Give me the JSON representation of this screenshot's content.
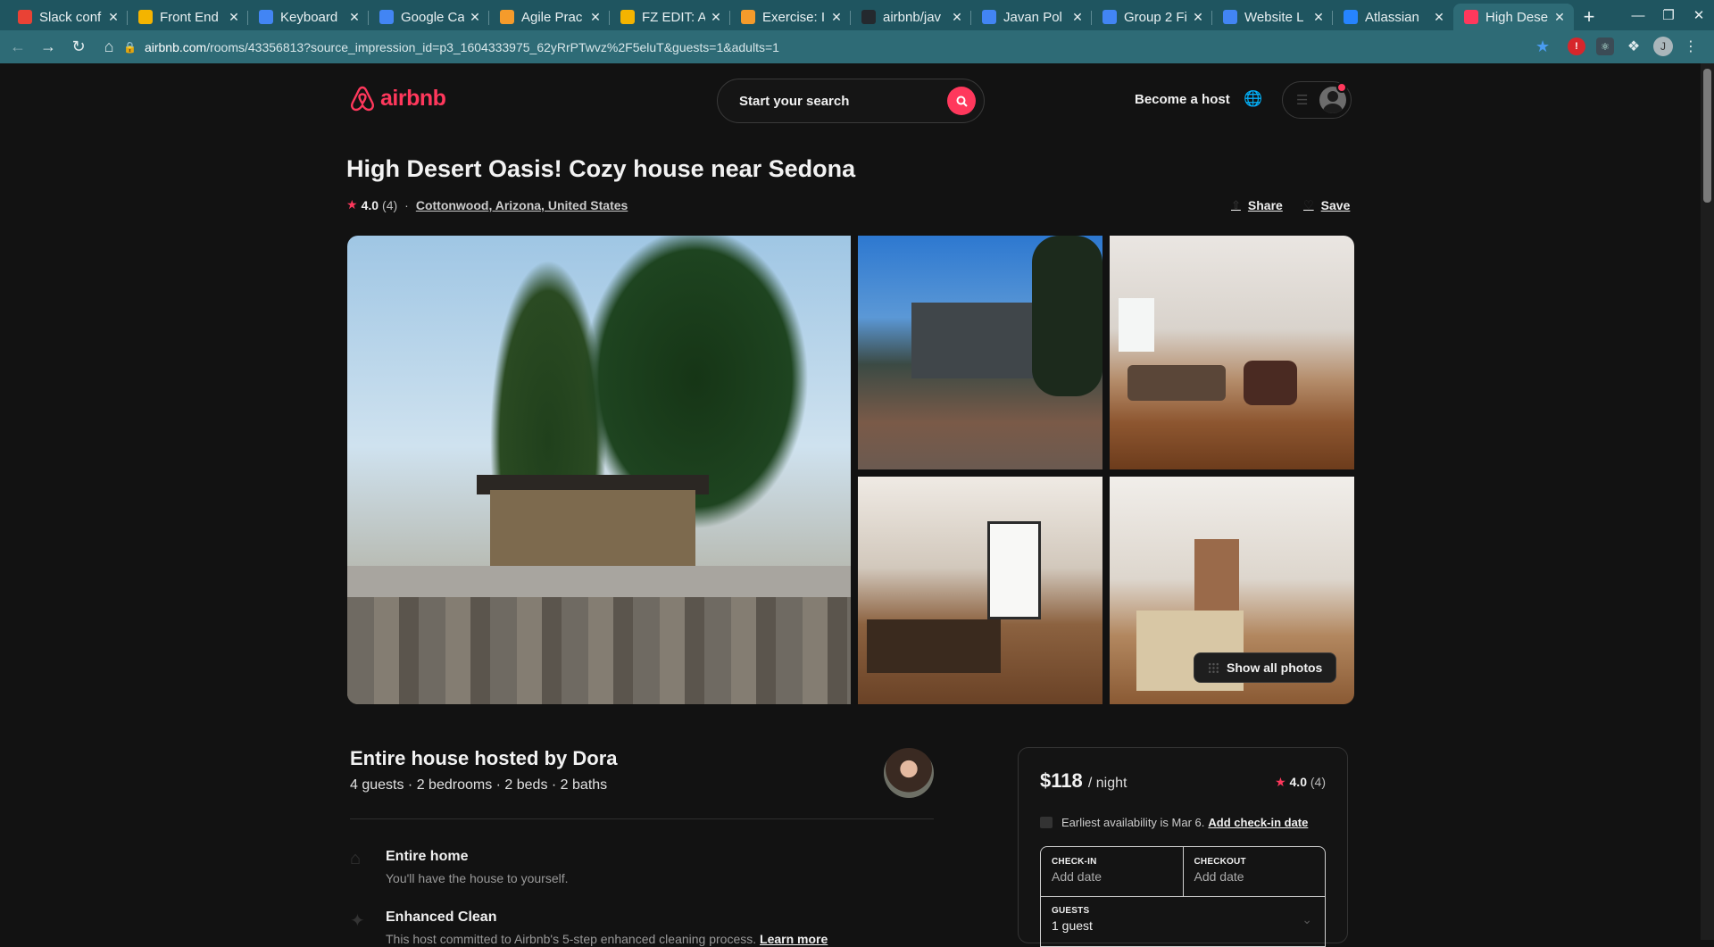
{
  "browser": {
    "tabs": [
      {
        "title": "Slack conf",
        "icon": "gmail-icon",
        "color": "#e94235"
      },
      {
        "title": "Front End",
        "icon": "drive-icon",
        "color": "#f4b400"
      },
      {
        "title": "Keyboard",
        "icon": "docs-icon",
        "color": "#4285f4"
      },
      {
        "title": "Google Ca",
        "icon": "slides-icon",
        "color": "#4285f4"
      },
      {
        "title": "Agile Prac",
        "icon": "kajabi-icon",
        "color": "#f59b2b"
      },
      {
        "title": "FZ EDIT: A",
        "icon": "slides-icon",
        "color": "#f4b400"
      },
      {
        "title": "Exercise: I",
        "icon": "kajabi-icon",
        "color": "#f59b2b"
      },
      {
        "title": "airbnb/jav",
        "icon": "github-icon",
        "color": "#24292e"
      },
      {
        "title": "Javan Pol",
        "icon": "docs-icon",
        "color": "#4285f4"
      },
      {
        "title": "Group 2 Fi",
        "icon": "docs-icon",
        "color": "#4285f4"
      },
      {
        "title": "Website L",
        "icon": "docs-icon",
        "color": "#4285f4"
      },
      {
        "title": "Atlassian",
        "icon": "atlassian-icon",
        "color": "#2684ff"
      },
      {
        "title": "High Dese",
        "icon": "airbnb-icon",
        "color": "#ff385c",
        "active": true
      }
    ],
    "url_host": "airbnb.com",
    "url_path": "/rooms/43356813?source_impression_id=p3_1604333975_62yRrPTwvz%2F5eluT&guests=1&adults=1",
    "profile_initial": "J"
  },
  "header": {
    "logo_text": "airbnb",
    "search_placeholder": "Start your search",
    "become_host": "Become a host"
  },
  "listing": {
    "title": "High Desert Oasis! Cozy house near Sedona",
    "rating": "4.0",
    "review_count": "(4)",
    "location": "Cottonwood, Arizona, United States",
    "share_label": "Share",
    "save_label": "Save",
    "show_all_photos": "Show all photos",
    "hosted_by": "Entire house hosted by Dora",
    "specs": "4 guests · 2 bedrooms · 2 beds · 2 baths",
    "features": [
      {
        "title": "Entire home",
        "desc": "You'll have the house to yourself."
      },
      {
        "title": "Enhanced Clean",
        "desc": "This host committed to Airbnb's 5-step enhanced cleaning process.",
        "link": "Learn more"
      }
    ]
  },
  "booking": {
    "price": "$118",
    "per_night": "/ night",
    "rating": "4.0",
    "review_count": "(4)",
    "availability": "Earliest availability is Mar 6.",
    "add_checkin": "Add check-in date",
    "checkin_label": "CHECK-IN",
    "checkin_value": "Add date",
    "checkout_label": "CHECKOUT",
    "checkout_value": "Add date",
    "guests_label": "GUESTS",
    "guests_value": "1 guest"
  },
  "colors": {
    "brand": "#ff385c",
    "tabstrip": "#1f5560",
    "toolbar": "#2e6b76"
  }
}
